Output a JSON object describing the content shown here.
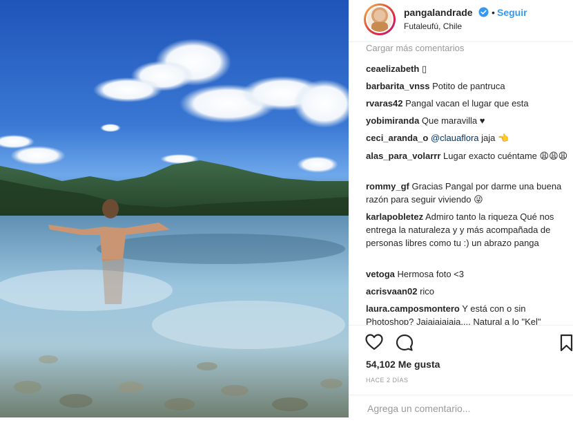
{
  "header": {
    "username": "pangalandrade",
    "separator": "•",
    "follow_label": "Seguir",
    "location": "Futaleufú, Chile"
  },
  "comments": {
    "load_more": "Cargar más comentarios",
    "items": [
      {
        "user": "ceaelizabeth",
        "text": "▯"
      },
      {
        "user": "barbarita_vnss",
        "text": "Potito de pantruca"
      },
      {
        "user": "rvaras42",
        "text": "Pangal vacan el lugar que esta"
      },
      {
        "user": "yobimiranda",
        "text": "Que maravilla ♥"
      },
      {
        "user": "ceci_aranda_o",
        "mention": "@clauaflora",
        "text": "jaja 👈"
      },
      {
        "user": "alas_para_volarrr",
        "text": "Lugar exacto cuéntame 😩😩😩"
      },
      {
        "user": "rommy_gf",
        "text": "Gracias Pangal por darme una buena razón para seguir viviendo 😜"
      },
      {
        "user": "karlapobletez",
        "text": "Admiro tanto la riqueza Qué nos entrega la naturaleza y y más acompañada de personas libres como tu :) un abrazo panga"
      },
      {
        "user": "vetoga",
        "text": "Hermosa foto <3"
      },
      {
        "user": "acrisvaan02",
        "text": "rico"
      },
      {
        "user": "laura.camposmontero",
        "text": "Y está con o sin Photoshop? Jajajajajaja.... Natural a lo \"Kel\""
      }
    ]
  },
  "actions": {
    "icons": [
      "heart-icon",
      "comment-icon",
      "bookmark-icon"
    ],
    "likes": "54,102 Me gusta",
    "time": "HACE 2 DÍAS"
  },
  "add_comment": {
    "placeholder": "Agrega un comentario..."
  },
  "colors": {
    "accent": "#3897f0",
    "text": "#262626",
    "muted": "#999999",
    "border": "#efefef"
  }
}
